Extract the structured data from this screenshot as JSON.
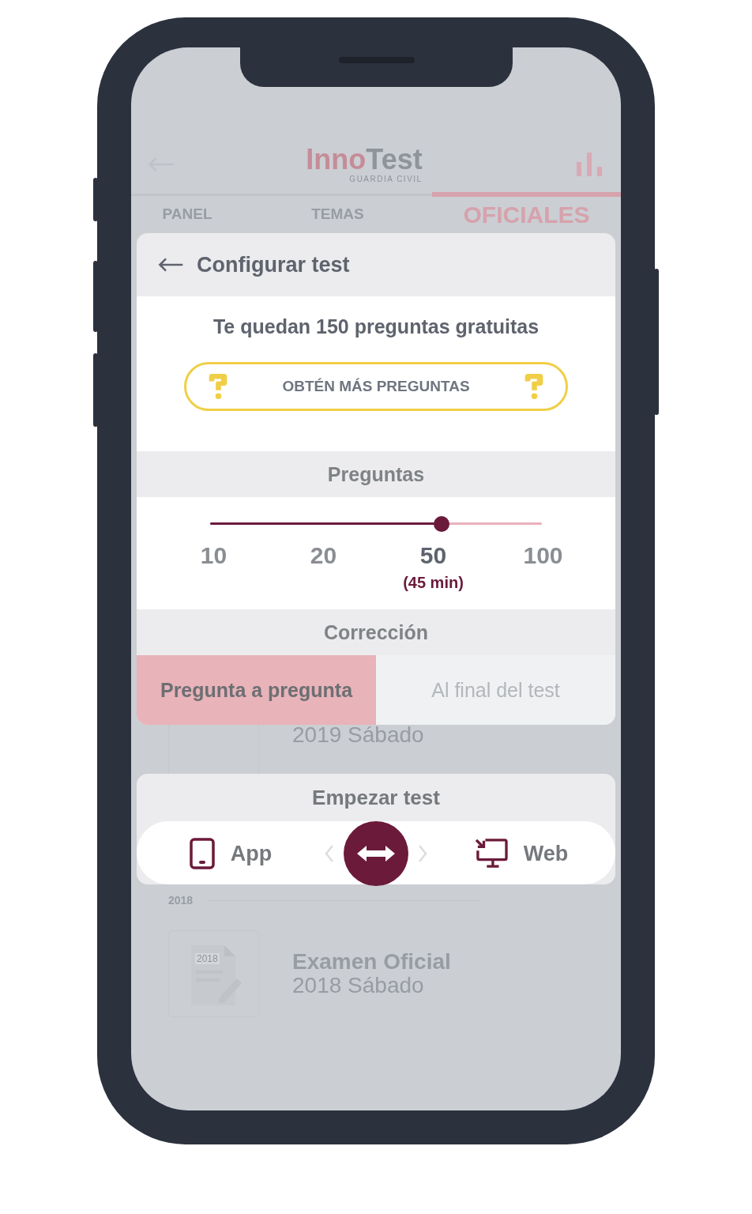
{
  "app_bar": {
    "logo": {
      "first": "Inno",
      "second": "Test",
      "subtitle": "GUARDIA CIVIL"
    }
  },
  "tabs": [
    {
      "label": "PANEL",
      "selected": false
    },
    {
      "label": "TEMAS",
      "selected": false
    },
    {
      "label": "OFICIALES",
      "selected": true
    }
  ],
  "exams": [
    {
      "kind": "item",
      "subtitle": "2019 Sábado"
    },
    {
      "kind": "year",
      "label": "2018"
    },
    {
      "kind": "item",
      "badge": "2018",
      "title": "Examen Oficial",
      "subtitle": "2018 Sábado"
    }
  ],
  "dialog": {
    "title": "Configurar test",
    "remaining": "Te quedan 150 preguntas gratuitas",
    "more_button": "OBTÉN MÁS PREGUNTAS",
    "questions": {
      "heading": "Preguntas",
      "level": 0.667,
      "duration": "(45 min)",
      "options": [
        {
          "label": "10",
          "selected": false
        },
        {
          "label": "20",
          "selected": false
        },
        {
          "label": "50",
          "selected": true
        },
        {
          "label": "100",
          "selected": false
        }
      ]
    },
    "correction": {
      "heading": "Corrección",
      "options": [
        {
          "label": "Pregunta a pregunta",
          "selected": true
        },
        {
          "label": "Al final del test",
          "selected": false
        }
      ]
    }
  },
  "start": {
    "heading": "Empezar test",
    "modes": [
      {
        "kind": "app",
        "label": "App"
      },
      {
        "kind": "web",
        "label": "Web"
      }
    ]
  }
}
